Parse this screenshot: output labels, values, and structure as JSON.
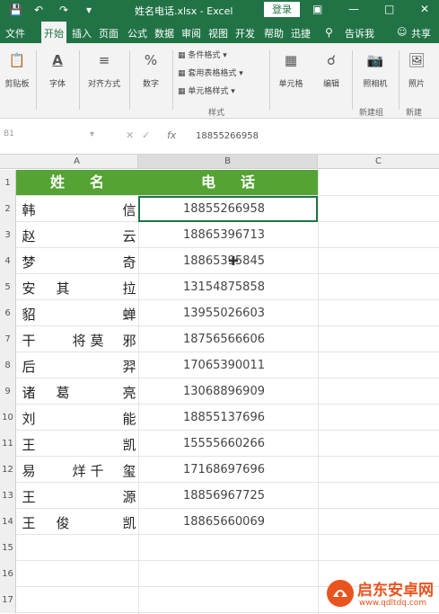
{
  "titlebar": {
    "title": "姓名电话.xlsx  -  Excel",
    "login": "登录",
    "save_icon": "save-icon",
    "undo_icon": "undo-icon",
    "redo_icon": "redo-icon",
    "accent": "#217346"
  },
  "tabs": [
    {
      "label": "文件"
    },
    {
      "label": "开始"
    },
    {
      "label": "插入"
    },
    {
      "label": "页面"
    },
    {
      "label": "公式"
    },
    {
      "label": "数据"
    },
    {
      "label": "审阅"
    },
    {
      "label": "视图"
    },
    {
      "label": "开发"
    },
    {
      "label": "帮助"
    },
    {
      "label": "迅捷"
    },
    {
      "label": "告诉我"
    },
    {
      "label": "共享"
    }
  ],
  "ribbon": {
    "groups": [
      {
        "label": "剪贴板"
      },
      {
        "label": "字体"
      },
      {
        "label": "对齐方式"
      },
      {
        "label": "数字"
      },
      {
        "label": "单元格"
      },
      {
        "label": "编辑"
      },
      {
        "label": "照相机"
      },
      {
        "label": "照片"
      }
    ],
    "styles": {
      "conditional": "条件格式 ▾",
      "table": "套用表格格式 ▾",
      "cell": "单元格样式 ▾",
      "group_label": "样式"
    },
    "new_group": "新建组",
    "new_group2": "新建"
  },
  "formula_bar": {
    "namebox": "B1",
    "fx": "fx",
    "value": "18855266958"
  },
  "columns": [
    "A",
    "B",
    "C"
  ],
  "rows": [
    "1",
    "2",
    "3",
    "4",
    "5",
    "6",
    "7",
    "8",
    "9",
    "10",
    "11",
    "12",
    "13",
    "14",
    "15",
    "16",
    "17"
  ],
  "header": {
    "name": "姓名",
    "phone": "电话"
  },
  "records": [
    {
      "chars": [
        "韩",
        "",
        "",
        "信"
      ],
      "phone": "18855266958"
    },
    {
      "chars": [
        "赵",
        "",
        "",
        "云"
      ],
      "phone": "18865396713"
    },
    {
      "chars": [
        "梦",
        "",
        "",
        "奇"
      ],
      "phone": "18865395845"
    },
    {
      "chars": [
        "安",
        "其",
        "",
        "拉"
      ],
      "phone": "13154875858"
    },
    {
      "chars": [
        "貂",
        "",
        "",
        "蝉"
      ],
      "phone": "13955026603"
    },
    {
      "chars": [
        "干",
        "将",
        "莫",
        "邪"
      ],
      "phone": "18756566606"
    },
    {
      "chars": [
        "后",
        "",
        "",
        "羿"
      ],
      "phone": "17065390011"
    },
    {
      "chars": [
        "诸",
        "葛",
        "",
        "亮"
      ],
      "phone": "13068896909"
    },
    {
      "chars": [
        "刘",
        "",
        "",
        "能"
      ],
      "phone": "18855137696"
    },
    {
      "chars": [
        "王",
        "",
        "",
        "凯"
      ],
      "phone": "15555660266"
    },
    {
      "chars": [
        "易",
        "烊",
        "千",
        "玺"
      ],
      "phone": "17168697696"
    },
    {
      "chars": [
        "王",
        "",
        "",
        "源"
      ],
      "phone": "18856967725"
    },
    {
      "chars": [
        "王",
        "俊",
        "",
        "凯"
      ],
      "phone": "18865660069"
    }
  ],
  "watermark": {
    "text": "启东安卓网",
    "url": "www.qdltdq.com"
  }
}
